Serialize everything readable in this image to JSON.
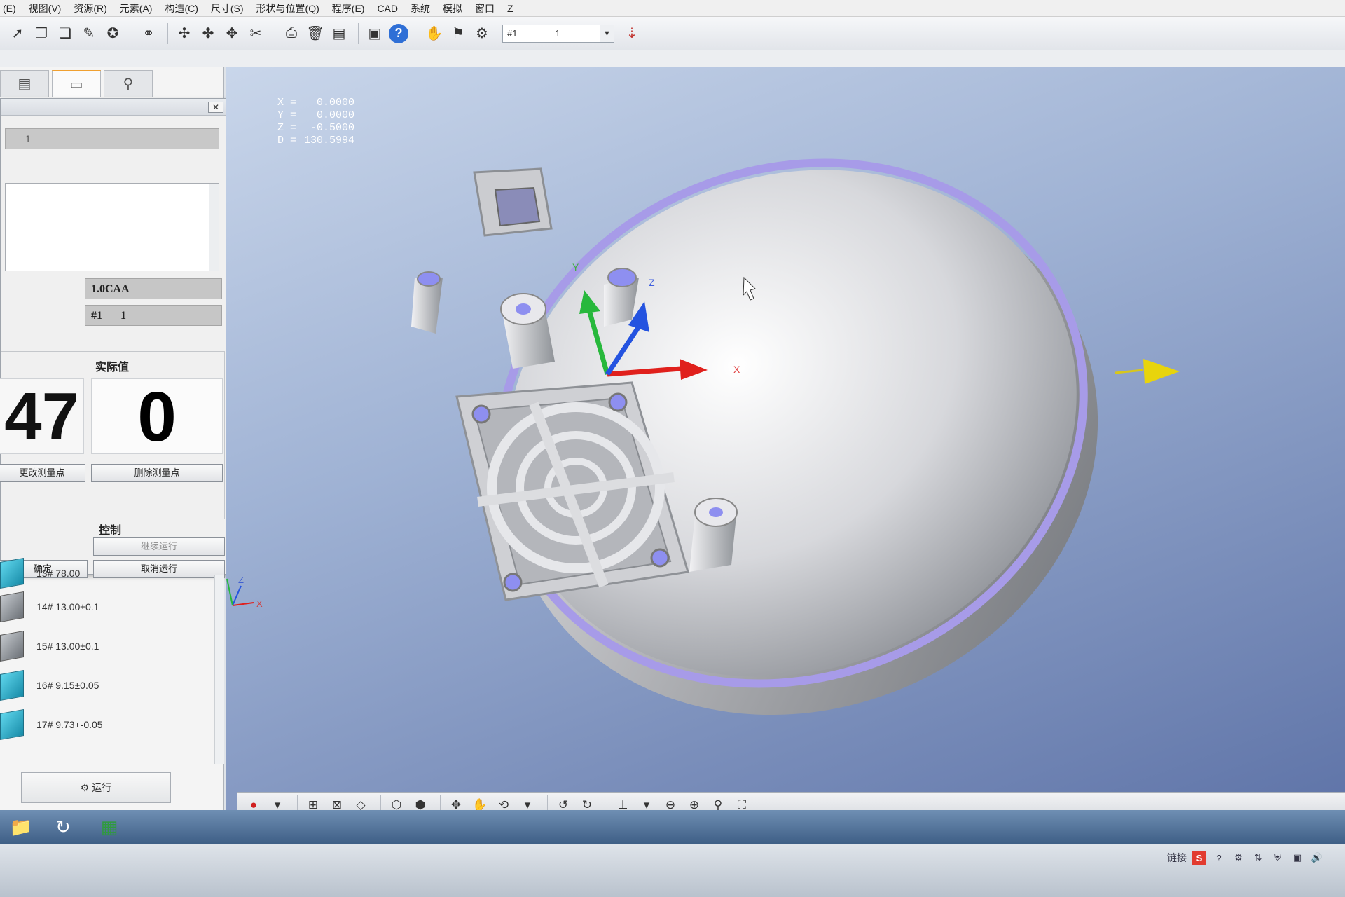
{
  "menubar": {
    "items": [
      "(E)",
      "视图(V)",
      "资源(R)",
      "元素(A)",
      "构造(C)",
      "尺寸(S)",
      "形状与位置(Q)",
      "程序(E)",
      "CAD",
      "系统",
      "模拟",
      "窗口",
      "Z"
    ]
  },
  "toolbar": {
    "help_label": "?",
    "probe_label": "#1",
    "probe_value": "1",
    "dropdown_glyph": "▼"
  },
  "dialog": {
    "close_glyph": "✕",
    "field1_value": "1",
    "caa_value": "1.0CAA",
    "probe_name": "#1",
    "probe_num": "1",
    "actual_label": "实际值",
    "big_left_value": "47",
    "big_right_value": "0",
    "change_point_label": "更改测量点",
    "delete_point_label": "删除测量点",
    "control_label": "控制",
    "continue_label": "继续运行",
    "ok_label": "确定",
    "cancel_label": "取消运行"
  },
  "features": [
    {
      "name": "13# 78.00",
      "color": "cyan"
    },
    {
      "name": "14# 13.00±0.1",
      "color": "gray"
    },
    {
      "name": "15# 13.00±0.1",
      "color": "gray"
    },
    {
      "name": "16# 9.15±0.05",
      "color": "cyan"
    },
    {
      "name": "17# 9.73+-0.05",
      "color": "cyan"
    }
  ],
  "run_button_label": "运行",
  "viewport": {
    "coords": [
      {
        "axis": "X =",
        "value": "0.0000"
      },
      {
        "axis": "Y =",
        "value": "0.0000"
      },
      {
        "axis": "Z =",
        "value": "-0.5000"
      },
      {
        "axis": "D =",
        "value": "130.5994"
      }
    ],
    "axis_labels": {
      "x": "X",
      "y": "Y",
      "z": "Z"
    },
    "colors": {
      "x_axis": "#e0201c",
      "y_axis": "#27b83c",
      "z_axis": "#2453e0",
      "arrow": "#e8d40c",
      "rim": "#a79be8"
    }
  },
  "tray": {
    "link_label": "链接",
    "ime_label": "S"
  }
}
